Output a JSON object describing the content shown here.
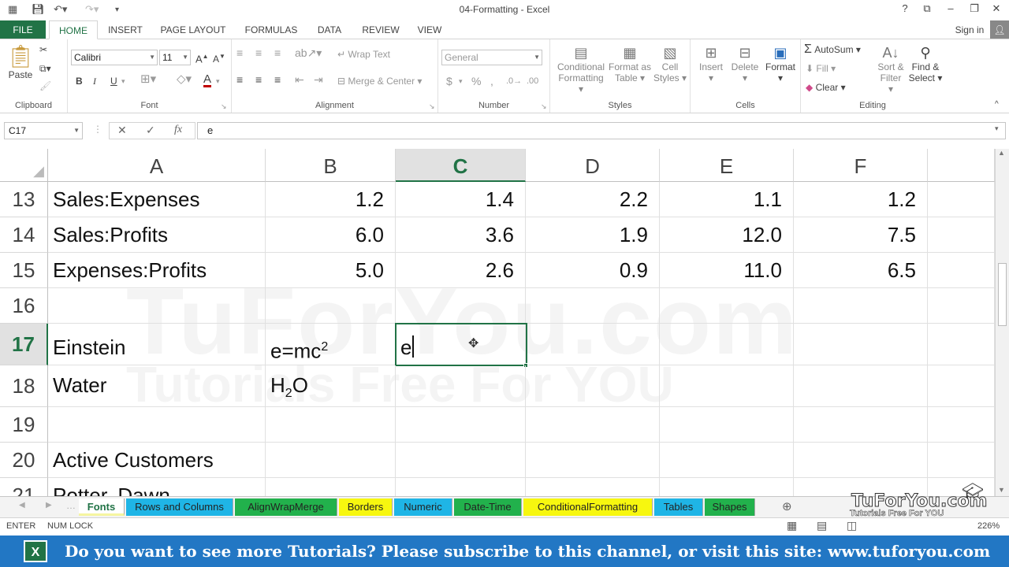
{
  "window": {
    "title": "04-Formatting - Excel",
    "help": "?",
    "signin": "Sign in"
  },
  "ribbon_tabs": [
    "FILE",
    "HOME",
    "INSERT",
    "PAGE LAYOUT",
    "FORMULAS",
    "DATA",
    "REVIEW",
    "VIEW"
  ],
  "clipboard": {
    "paste": "Paste",
    "label": "Clipboard"
  },
  "font": {
    "name": "Calibri",
    "size": "11",
    "bold": "B",
    "italic": "I",
    "underline": "U",
    "label": "Font"
  },
  "alignment": {
    "wrap": "Wrap Text",
    "merge": "Merge & Center",
    "label": "Alignment"
  },
  "number": {
    "format": "General",
    "currency": "$",
    "percent": "%",
    "comma": ",",
    "label": "Number"
  },
  "styles": {
    "conditional": [
      "Conditional",
      "Formatting"
    ],
    "format_table": [
      "Format as",
      "Table"
    ],
    "cell_styles": [
      "Cell",
      "Styles"
    ],
    "label": "Styles"
  },
  "cells": {
    "insert": "Insert",
    "delete": "Delete",
    "format": "Format",
    "label": "Cells"
  },
  "editing": {
    "autosum": "AutoSum",
    "fill": "Fill",
    "clear": "Clear",
    "sort": [
      "Sort &",
      "Filter"
    ],
    "find": [
      "Find &",
      "Select"
    ],
    "label": "Editing"
  },
  "formula_bar": {
    "name_box": "C17",
    "fx": "fx",
    "value": "e"
  },
  "columns": [
    "A",
    "B",
    "C",
    "D",
    "E",
    "F"
  ],
  "rows": [
    {
      "n": "13",
      "a": "Sales:Expenses",
      "b": "1.2",
      "c": "1.4",
      "d": "2.2",
      "e": "1.1",
      "f": "1.2"
    },
    {
      "n": "14",
      "a": "Sales:Profits",
      "b": "6.0",
      "c": "3.6",
      "d": "1.9",
      "e": "12.0",
      "f": "7.5"
    },
    {
      "n": "15",
      "a": "Expenses:Profits",
      "b": "5.0",
      "c": "2.6",
      "d": "0.9",
      "e": "11.0",
      "f": "6.5"
    },
    {
      "n": "16"
    },
    {
      "n": "17",
      "a": "Einstein",
      "b_base": "e=mc",
      "b_sup": "2",
      "c": "e"
    },
    {
      "n": "18",
      "a": "Water",
      "b_pre": "H",
      "b_sub": "2",
      "b_post": "O"
    },
    {
      "n": "19"
    },
    {
      "n": "20",
      "a": "Active Customers"
    },
    {
      "n": "21",
      "a": "Potter, Dawn"
    }
  ],
  "selected": {
    "col": "C",
    "row": "17"
  },
  "watermark": {
    "line1": "TuForYou.com",
    "line2": "Tutorials Free For YOU"
  },
  "sheet_tabs": [
    {
      "label": "Fonts",
      "color": "#f5f5a0",
      "active": true
    },
    {
      "label": "Rows and Columns",
      "color": "#1fb5e6"
    },
    {
      "label": "AlignWrapMerge",
      "color": "#22b14c"
    },
    {
      "label": "Borders",
      "color": "#f7f70f"
    },
    {
      "label": "Numeric",
      "color": "#1fb5e6"
    },
    {
      "label": "Date-Time",
      "color": "#22b14c"
    },
    {
      "label": "ConditionalFormatting",
      "color": "#f7f70f"
    },
    {
      "label": "Tables",
      "color": "#1fb5e6"
    },
    {
      "label": "Shapes",
      "color": "#22b14c"
    }
  ],
  "status": {
    "mode": "ENTER",
    "numlock": "NUM LOCK",
    "zoom": "226%"
  },
  "banner": {
    "text": "Do you want to see more Tutorials? Please subscribe to this channel, or visit this site: www.tuforyou.com",
    "icon": "X"
  },
  "logo": {
    "line1": "TuForYou.com",
    "line2": "Tutorials Free For YOU"
  }
}
